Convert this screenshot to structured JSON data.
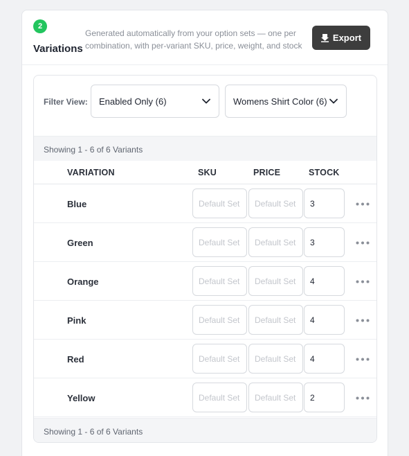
{
  "section": {
    "step": "2",
    "title": "Variations",
    "description": "Generated automatically from your option sets — one per combination, with per-variant SKU, price, weight, and stock",
    "export_label": "Export"
  },
  "filter": {
    "label": "Filter View:",
    "view_select": "Enabled Only (6)",
    "color_select": "Womens Shirt Color (6)"
  },
  "table": {
    "showing_top": "Showing 1 - 6 of 6 Variants",
    "showing_bottom": "Showing 1 - 6 of 6 Variants",
    "columns": {
      "variation": "VARIATION",
      "sku": "SKU",
      "price": "PRICE",
      "stock": "STOCK"
    },
    "placeholder_sku": "Default Set",
    "placeholder_price": "Default Set",
    "rows": [
      {
        "label": "Blue",
        "stock": "3"
      },
      {
        "label": "Green",
        "stock": "3"
      },
      {
        "label": "Orange",
        "stock": "4"
      },
      {
        "label": "Pink",
        "stock": "4"
      },
      {
        "label": "Red",
        "stock": "4"
      },
      {
        "label": "Yellow",
        "stock": "2"
      }
    ]
  },
  "icons": {
    "export": "download-icon",
    "select": "chevron-down-icon",
    "row_menu": "more-horizontal-icon"
  },
  "colors": {
    "accent_green": "#22c55e",
    "button_dark": "#3d3d3d"
  }
}
